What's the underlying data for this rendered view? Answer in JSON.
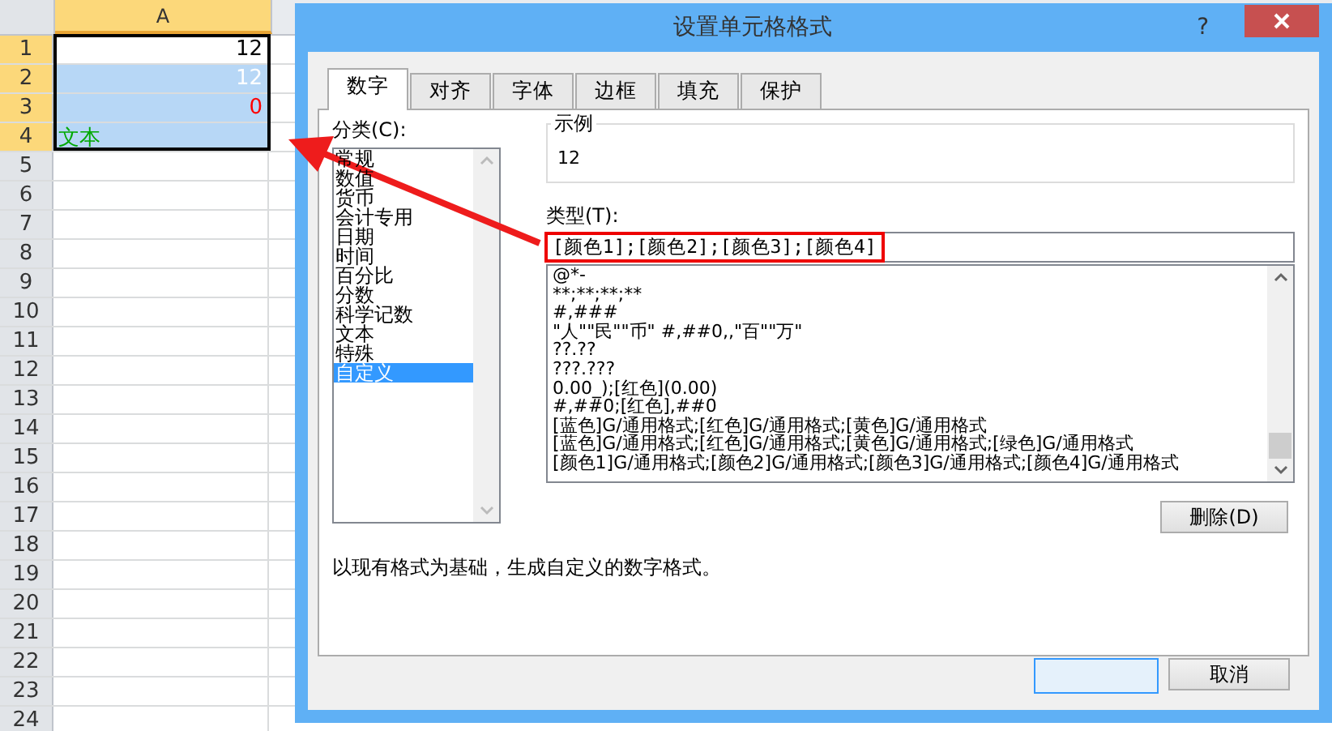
{
  "sheet": {
    "column_header": {
      "label": "A",
      "selected": true
    },
    "rows": [
      {
        "number": "1",
        "selected": true,
        "cell": {
          "value": "12",
          "color": "#000000",
          "kind": "number",
          "selected": false
        }
      },
      {
        "number": "2",
        "selected": true,
        "cell": {
          "value": "12",
          "color": "#ffffff",
          "kind": "number",
          "selected": true
        }
      },
      {
        "number": "3",
        "selected": true,
        "cell": {
          "value": "0",
          "color": "#ff0000",
          "kind": "number",
          "selected": true
        }
      },
      {
        "number": "4",
        "selected": true,
        "cell": {
          "value": "文本",
          "color": "#00a800",
          "kind": "text",
          "selected": true
        }
      },
      {
        "number": "5",
        "selected": false
      },
      {
        "number": "6",
        "selected": false
      },
      {
        "number": "7",
        "selected": false
      },
      {
        "number": "8",
        "selected": false
      },
      {
        "number": "9",
        "selected": false
      },
      {
        "number": "10",
        "selected": false
      },
      {
        "number": "11",
        "selected": false
      },
      {
        "number": "12",
        "selected": false
      },
      {
        "number": "13",
        "selected": false
      },
      {
        "number": "14",
        "selected": false
      },
      {
        "number": "15",
        "selected": false
      },
      {
        "number": "16",
        "selected": false
      },
      {
        "number": "17",
        "selected": false
      },
      {
        "number": "18",
        "selected": false
      },
      {
        "number": "19",
        "selected": false
      },
      {
        "number": "20",
        "selected": false
      },
      {
        "number": "21",
        "selected": false
      },
      {
        "number": "22",
        "selected": false
      },
      {
        "number": "23",
        "selected": false
      },
      {
        "number": "24",
        "selected": false
      }
    ]
  },
  "dialog": {
    "title": "设置单元格格式",
    "help": "?",
    "tabs": [
      {
        "label": "数字",
        "selected": true
      },
      {
        "label": "对齐",
        "selected": false
      },
      {
        "label": "字体",
        "selected": false
      },
      {
        "label": "边框",
        "selected": false
      },
      {
        "label": "填充",
        "selected": false
      },
      {
        "label": "保护",
        "selected": false
      }
    ],
    "category_label": "分类(C):",
    "categories": [
      {
        "label": "常规",
        "selected": false
      },
      {
        "label": "数值",
        "selected": false
      },
      {
        "label": "货币",
        "selected": false
      },
      {
        "label": "会计专用",
        "selected": false
      },
      {
        "label": "日期",
        "selected": false
      },
      {
        "label": "时间",
        "selected": false
      },
      {
        "label": "百分比",
        "selected": false
      },
      {
        "label": "分数",
        "selected": false
      },
      {
        "label": "科学记数",
        "selected": false
      },
      {
        "label": "文本",
        "selected": false
      },
      {
        "label": "特殊",
        "selected": false
      },
      {
        "label": "自定义",
        "selected": true
      }
    ],
    "sample": {
      "label": "示例",
      "value": "12"
    },
    "type": {
      "label": "类型(T):",
      "value": "[颜色1];[颜色2];[颜色3];[颜色4]"
    },
    "formats": [
      {
        "label": "@*-",
        "selected": false
      },
      {
        "label": "**;**;**;**",
        "selected": false
      },
      {
        "label": "#,###",
        "selected": false
      },
      {
        "label": "\"人\"\"民\"\"币\" #,##0,,\"百\"\"万\"",
        "selected": false
      },
      {
        "label": "??.??",
        "selected": false
      },
      {
        "label": "???.???",
        "selected": false
      },
      {
        "label": "0.00_);[红色](0.00)",
        "selected": false
      },
      {
        "label": "#,##0;[红色],##0",
        "selected": false
      },
      {
        "label": "[蓝色]G/通用格式;[红色]G/通用格式;[黄色]G/通用格式",
        "selected": false
      },
      {
        "label": "[蓝色]G/通用格式;[红色]G/通用格式;[黄色]G/通用格式;[绿色]G/通用格式",
        "selected": false
      },
      {
        "label": "[颜色1]G/通用格式;[颜色2]G/通用格式;[颜色3]G/通用格式;[颜色4]G/通用格式",
        "selected": false
      }
    ],
    "delete_button": "删除(D)",
    "description": "以现有格式为基础，生成自定义的数字格式。",
    "cancel_button": "取消"
  }
}
